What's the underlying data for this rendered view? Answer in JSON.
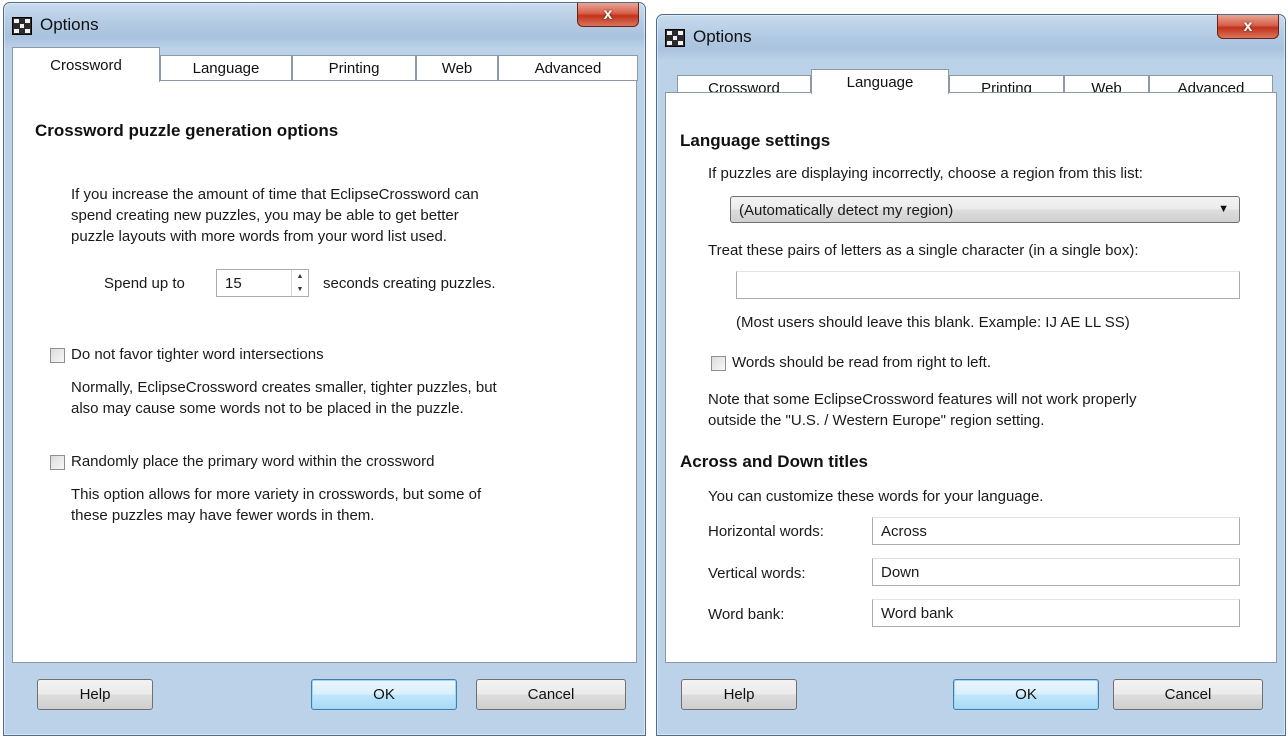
{
  "left_window": {
    "title": "Options",
    "close_label": "x",
    "tabs": [
      {
        "label": "Crossword"
      },
      {
        "label": "Language"
      },
      {
        "label": "Printing"
      },
      {
        "label": "Web"
      },
      {
        "label": "Advanced"
      }
    ],
    "active_tab": "Crossword",
    "heading": "Crossword puzzle generation options",
    "intro_lines": [
      "If you increase the amount of time that EclipseCrossword can",
      "spend creating new puzzles, you may be able to get better",
      "puzzle layouts with more words from your word list used."
    ],
    "spend_prefix": "Spend up to",
    "spend_value": "15",
    "spend_suffix": "seconds creating puzzles.",
    "option_tighter": {
      "label": "Do not favor tighter word intersections",
      "checked": false,
      "desc_lines": [
        "Normally, EclipseCrossword creates smaller, tighter puzzles, but",
        "also may cause some words not to be placed in the puzzle."
      ]
    },
    "option_random": {
      "label": "Randomly place the primary word within the crossword",
      "checked": false,
      "desc_lines": [
        "This option allows for more variety in crosswords, but some of",
        "these puzzles may have fewer words in them."
      ]
    },
    "buttons": {
      "help": "Help",
      "ok": "OK",
      "cancel": "Cancel"
    }
  },
  "right_window": {
    "title": "Options",
    "close_label": "x",
    "tabs": [
      {
        "label": "Crossword"
      },
      {
        "label": "Language"
      },
      {
        "label": "Printing"
      },
      {
        "label": "Web"
      },
      {
        "label": "Advanced"
      }
    ],
    "active_tab": "Language",
    "language_heading": "Language settings",
    "region_prompt": "If puzzles are displaying incorrectly, choose a region from this list:",
    "region_selected": "(Automatically detect my region)",
    "pairs_prompt": "Treat these pairs of letters as a single character (in a single box):",
    "pairs_value": "",
    "pairs_hint": "(Most users should leave this blank.  Example: IJ AE LL SS)",
    "rtl_label": "Words should be read from right to left.",
    "rtl_checked": false,
    "note_lines": [
      "Note that some EclipseCrossword features will not work properly",
      "outside the \"U.S. / Western Europe\" region setting."
    ],
    "titles_heading": "Across and Down titles",
    "titles_intro": "You can customize these words for your language.",
    "fields": [
      {
        "label": "Horizontal words:",
        "value": "Across"
      },
      {
        "label": "Vertical words:",
        "value": "Down"
      },
      {
        "label": "Word bank:",
        "value": "Word bank"
      }
    ],
    "buttons": {
      "help": "Help",
      "ok": "OK",
      "cancel": "Cancel"
    }
  }
}
